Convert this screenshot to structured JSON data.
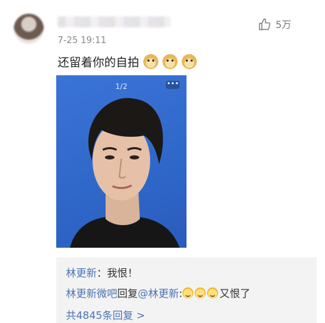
{
  "post": {
    "username": "",
    "timestamp": "7-25 19:11",
    "likes": "5万",
    "text": "还留着你的自拍",
    "emoji": [
      "doge",
      "doge",
      "doge"
    ]
  },
  "photo": {
    "counter": "1/2",
    "more": "•••"
  },
  "replies": [
    {
      "name": "林更新",
      "text": "：我恨！"
    },
    {
      "name": "林更新微吧",
      "reply_word": "回复",
      "mention": "@林更新",
      "colon": ":",
      "text": "又恨了"
    }
  ],
  "total_replies": "共4845条回复 >"
}
